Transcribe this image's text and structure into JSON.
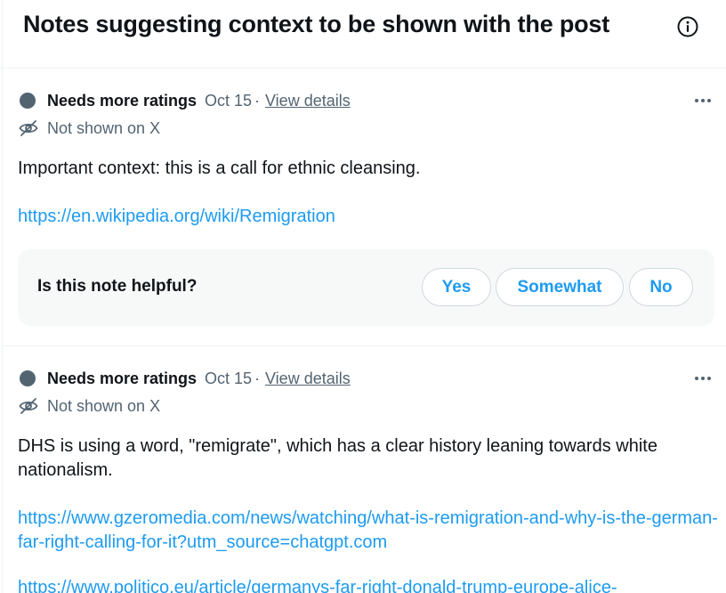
{
  "header": {
    "title": "Notes suggesting context to be shown with the post",
    "info_icon": "info-circle-icon"
  },
  "notes": [
    {
      "status": "Needs more ratings",
      "date": "Oct 15",
      "separator": "·",
      "details_link": "View details",
      "visibility": "Not shown on X",
      "text": "Important context: this is a call for ethnic cleansing.",
      "links": [
        "https://en.wikipedia.org/wiki/Remigration"
      ],
      "helpful": {
        "question": "Is this note helpful?",
        "options": [
          "Yes",
          "Somewhat",
          "No"
        ]
      }
    },
    {
      "status": "Needs more ratings",
      "date": "Oct 15",
      "separator": "·",
      "details_link": "View details",
      "visibility": "Not shown on X",
      "text": "DHS is using a word, \"remigrate\", which has a clear history leaning towards white nationalism.",
      "links": [
        "https://www.gzeromedia.com/news/watching/what-is-remigration-and-why-is-the-german-far-right-calling-for-it?utm_source=chatgpt.com",
        "https://www.politico.eu/article/germanys-far-right-donald-trump-europe-alice-"
      ]
    }
  ],
  "colors": {
    "accent": "#1d9bf0",
    "secondary_text": "#536471",
    "status_dot": "#536471"
  }
}
